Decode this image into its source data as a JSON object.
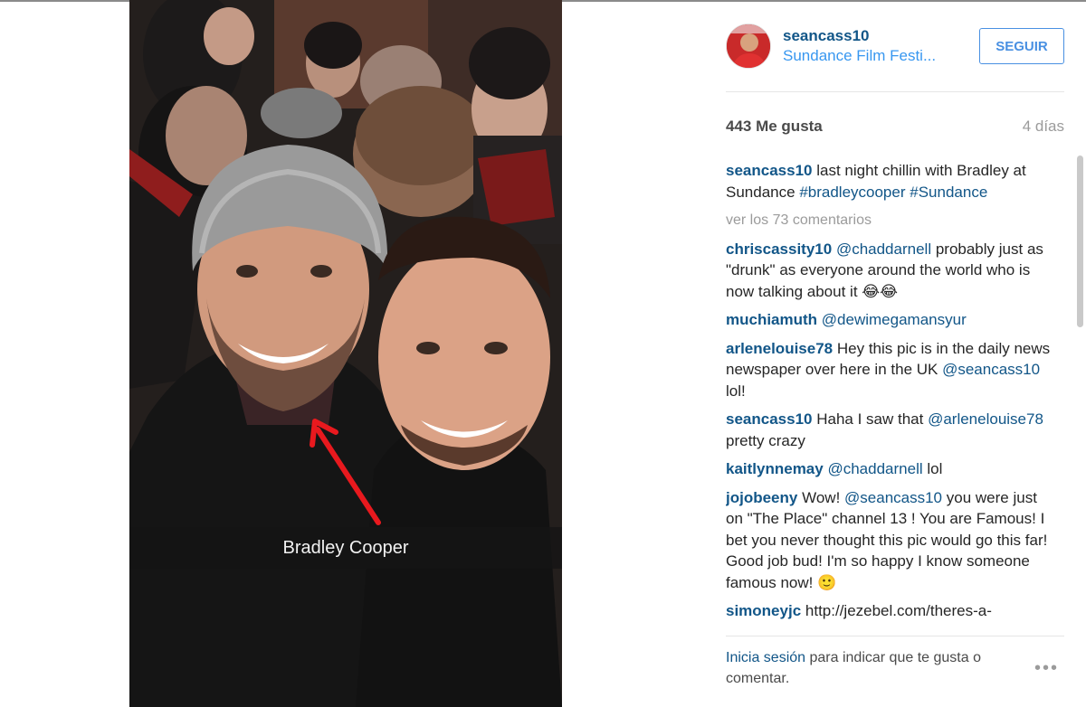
{
  "photo": {
    "caption": "Bradley Cooper"
  },
  "post": {
    "username": "seancass10",
    "location": "Sundance Film Festi...",
    "follow_label": "SEGUIR",
    "likes": "443 Me gusta",
    "age": "4 días"
  },
  "caption": {
    "user": "seancass10",
    "text": "last night chillin with Bradley at Sundance",
    "tag1": "#bradleycooper",
    "tag2": "#Sundance"
  },
  "view_more": "ver los 73 comentarios",
  "comments": [
    {
      "user": "chriscassity10",
      "mention": "@chaddarnell",
      "text": "probably just as \"drunk\" as everyone around the world who is now talking about it",
      "emoji": "😂😂"
    },
    {
      "user": "muchiamuth",
      "mention": "@dewimegamansyur",
      "text": ""
    },
    {
      "user": "arlenelouise78",
      "text": "Hey this pic is in the daily news newspaper over here in the UK",
      "mention": "@seancass10",
      "text2": "lol!"
    },
    {
      "user": "seancass10",
      "text": "Haha I saw that",
      "mention": "@arlenelouise78",
      "text2": "pretty crazy"
    },
    {
      "user": "kaitlynnemay",
      "mention": "@chaddarnell",
      "text": "lol"
    },
    {
      "user": "jojobeeny",
      "text": "Wow!",
      "mention": "@seancass10",
      "text2": "you were just on \"The Place\" channel 13 ! You are Famous! I bet you never thought this pic would go this far! Good job bud! I'm so happy I know someone famous now!",
      "emoji": "🙂"
    },
    {
      "user": "simoneyjc",
      "text": "http://jezebel.com/theres-a-"
    }
  ],
  "footer": {
    "login_link": "Inicia sesión",
    "login_text": "para indicar que te gusta o comentar.",
    "more_icon": "more-dots-icon"
  },
  "colors": {
    "username": "#125688",
    "link": "#3897f0",
    "button": "#4990e2",
    "annotation_arrow": "#e8191e"
  }
}
